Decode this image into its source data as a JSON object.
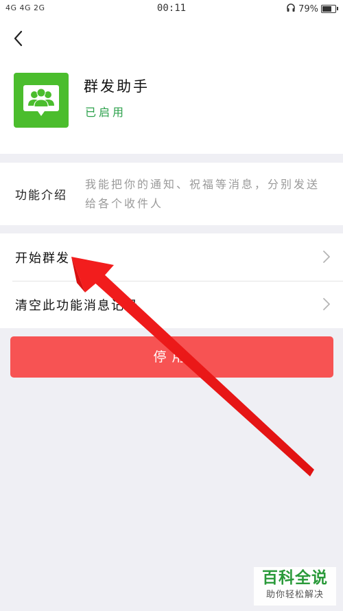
{
  "status_bar": {
    "signal_text": "4G 4G 2G",
    "time": "00:11",
    "battery": "79%",
    "battery_level": 0.79
  },
  "header": {
    "back_icon": "chevron-left-icon",
    "app_icon": "group-chat-icon",
    "app_icon_color": "#4bbd2d",
    "app_name": "群发助手",
    "app_status": "已启用",
    "app_status_color": "#2aa04a"
  },
  "intro": {
    "label": "功能介绍",
    "text": "我能把你的通知、祝福等消息，分别发送给各个收件人"
  },
  "menu": {
    "items": [
      {
        "label": "开始群发",
        "icon": "chevron-right-icon"
      },
      {
        "label": "清空此功能消息记录",
        "icon": "chevron-right-icon"
      }
    ]
  },
  "stop_button": {
    "label": "停用",
    "color": "#f75353"
  },
  "annotation": {
    "arrow_color": "#f21d1d",
    "points_to": "开始群发"
  },
  "watermark": {
    "main": "百科全说",
    "sub": "助你轻松解决"
  }
}
